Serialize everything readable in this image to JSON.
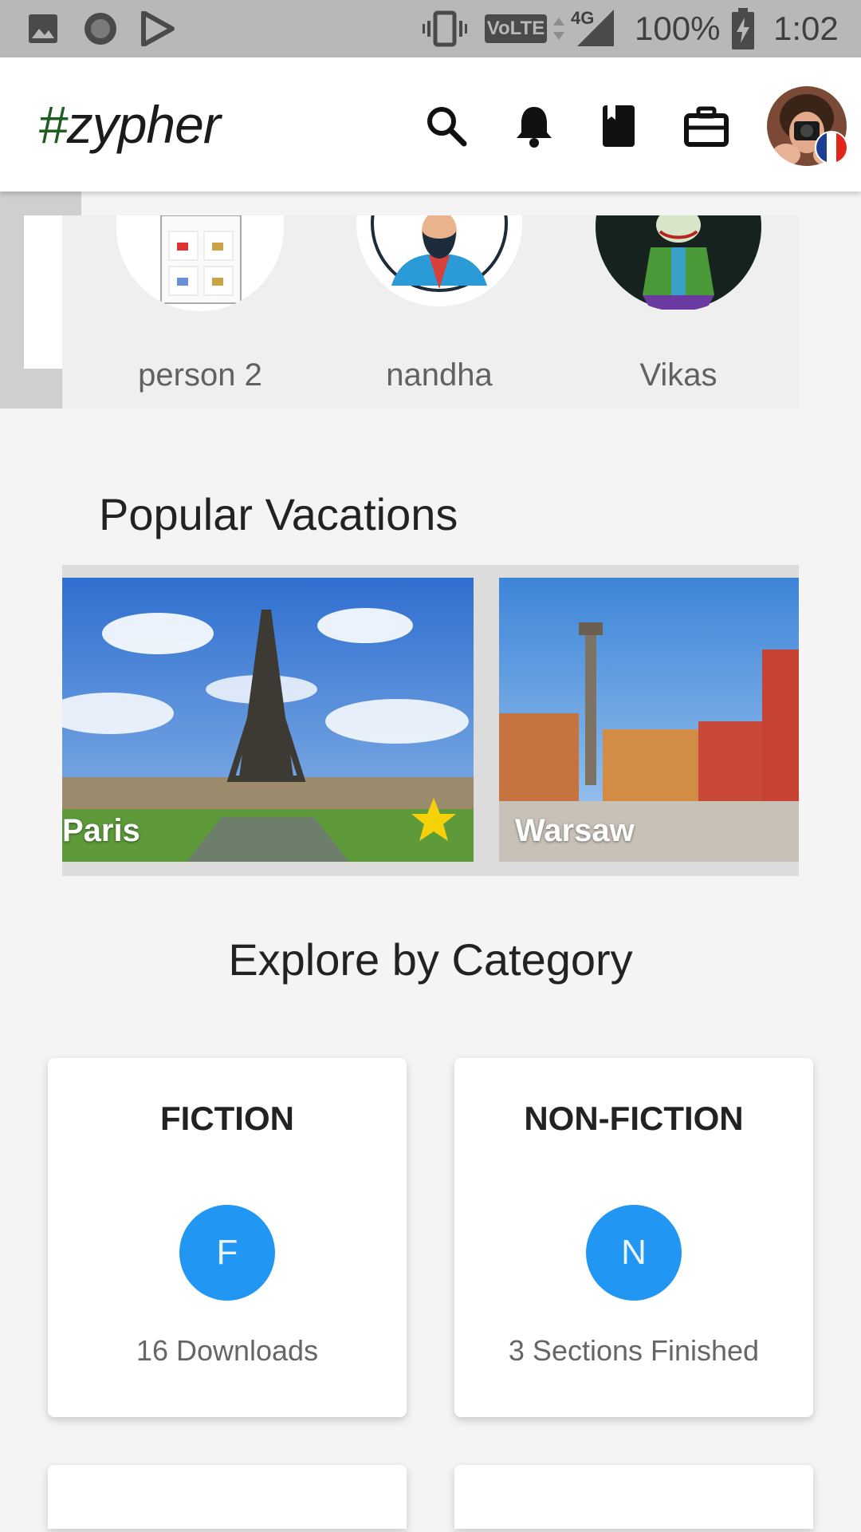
{
  "status_bar": {
    "network_lte": "VoLTE",
    "network_gen": "4G",
    "battery": "100%",
    "time": "1:02"
  },
  "app_bar": {
    "brand_hash": "#",
    "brand_name": "zypher",
    "icons": [
      "search-icon",
      "bell-icon",
      "book-icon",
      "briefcase-icon"
    ],
    "flag_colors": [
      "#1c3f94",
      "#ffffff",
      "#e1251b"
    ]
  },
  "people": [
    {
      "name": "person 2"
    },
    {
      "name": "nandha"
    },
    {
      "name": "Vikas"
    }
  ],
  "vacations": {
    "title": "Popular Vacations",
    "items": [
      {
        "label": "Paris",
        "favorite": true
      },
      {
        "label": "Warsaw",
        "favorite": false
      }
    ]
  },
  "categories": {
    "title": "Explore by Category",
    "items": [
      {
        "title": "FICTION",
        "initial": "F",
        "subtitle": "16 Downloads"
      },
      {
        "title": "NON-FICTION",
        "initial": "N",
        "subtitle": "3 Sections Finished"
      }
    ]
  },
  "colors": {
    "brand_hash": "#1f5d22",
    "accent": "#2196f3",
    "star": "#f5d10a"
  }
}
